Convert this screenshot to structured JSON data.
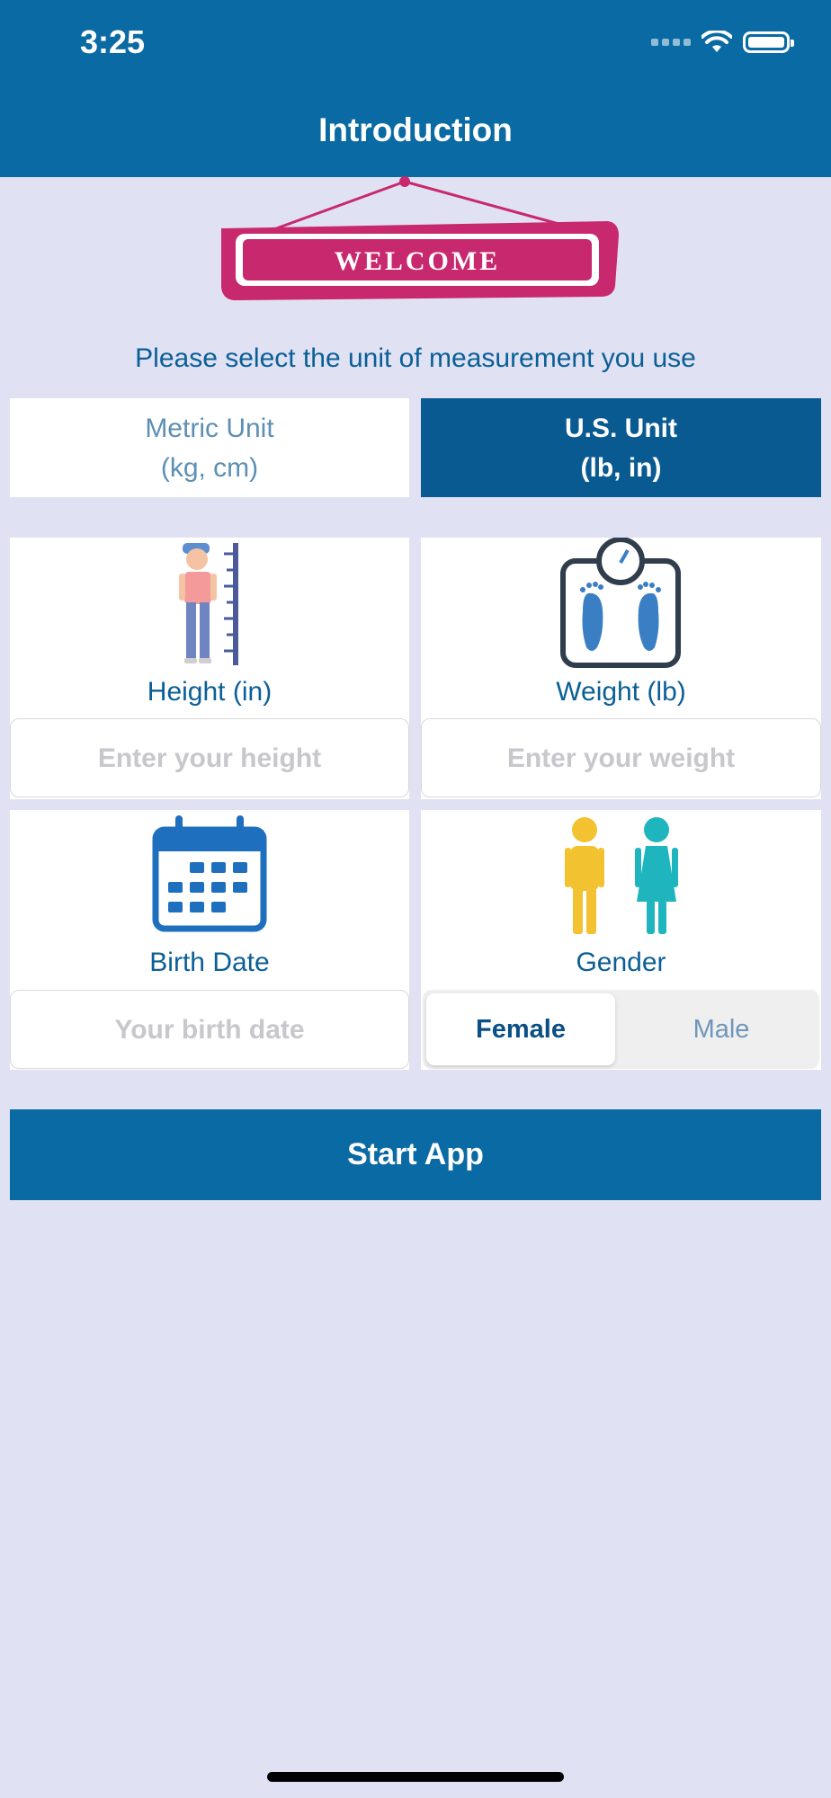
{
  "status_bar": {
    "time": "3:25"
  },
  "nav": {
    "title": "Introduction"
  },
  "banner": {
    "text": "WELCOME"
  },
  "prompt": "Please select the unit of measurement you use",
  "units": {
    "metric": {
      "line1": "Metric Unit",
      "line2": "(kg, cm)"
    },
    "us": {
      "line1": "U.S. Unit",
      "line2": "(lb, in)"
    },
    "selected": "U.S. Unit"
  },
  "height": {
    "label": "Height (in)",
    "placeholder": "Enter your height"
  },
  "weight": {
    "label": "Weight (lb)",
    "placeholder": "Enter your weight"
  },
  "birth": {
    "label": "Birth Date",
    "placeholder": "Your birth date"
  },
  "gender": {
    "label": "Gender",
    "options": [
      "Female",
      "Male"
    ],
    "selected": "Female"
  },
  "start_button": "Start App",
  "colors": {
    "primary": "#0a6aa3",
    "background": "#e0e2f3",
    "accent_pink": "#c8286e",
    "label_blue": "#0b5f96"
  }
}
